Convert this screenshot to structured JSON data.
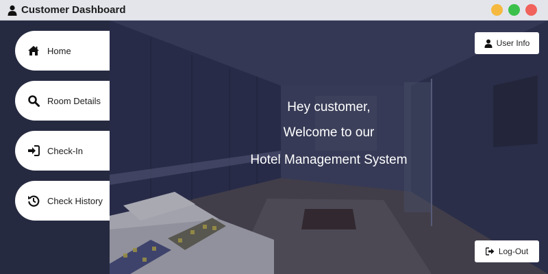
{
  "window": {
    "title": "Customer Dashboard",
    "icon": "user-icon",
    "controls": {
      "minimize_color": "#f5b93f",
      "maximize_color": "#3bc14b",
      "close_color": "#f0625b"
    }
  },
  "sidebar": {
    "items": [
      {
        "label": "Home",
        "icon": "home-icon"
      },
      {
        "label": "Room Details",
        "icon": "search-icon"
      },
      {
        "label": "Check-In",
        "icon": "sign-in-icon"
      },
      {
        "label": "Check History",
        "icon": "history-icon"
      }
    ]
  },
  "main": {
    "greeting": "Hey customer,",
    "welcome": "Welcome to our",
    "system_name": "Hotel Management System",
    "user_info_label": "User Info",
    "logout_label": "Log-Out"
  },
  "colors": {
    "sidebar_bg": "#262a40",
    "button_bg": "#ffffff"
  }
}
